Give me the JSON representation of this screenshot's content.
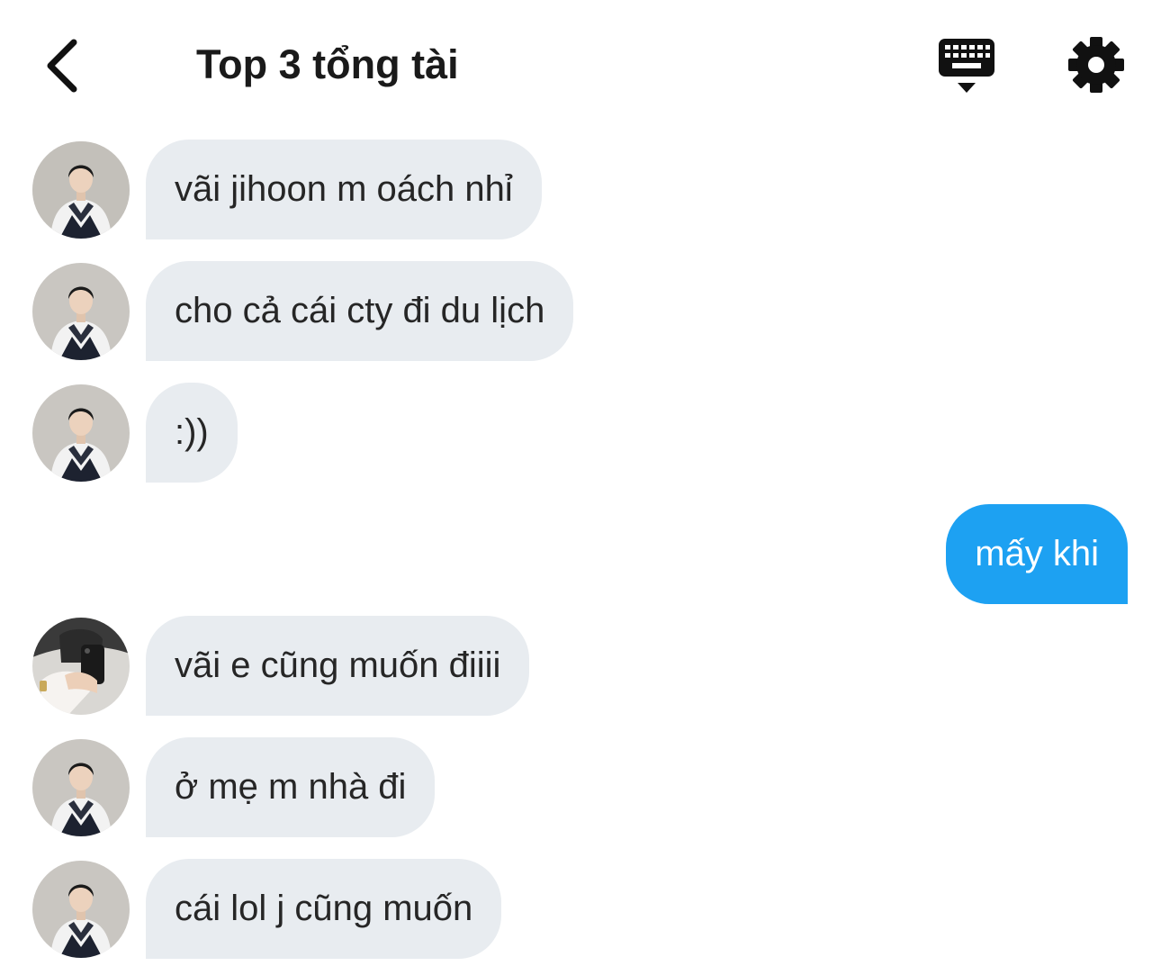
{
  "header": {
    "title": "Top 3 tổng tài",
    "back_icon": "chevron-left-icon",
    "keyboard_icon": "keyboard-icon",
    "settings_icon": "gear-icon"
  },
  "colors": {
    "incoming_bubble": "#e8ecf0",
    "outgoing_bubble": "#1da1f2",
    "outgoing_text": "#ffffff"
  },
  "messages": [
    {
      "direction": "incoming",
      "text": "vãi jihoon m oách nhỉ",
      "avatar": "avatar-user-a"
    },
    {
      "direction": "incoming",
      "text": "cho cả cái cty đi du lịch",
      "avatar": "avatar-user-a"
    },
    {
      "direction": "incoming",
      "text": ":))",
      "avatar": "avatar-user-a"
    },
    {
      "direction": "outgoing",
      "text": "mấy khi"
    },
    {
      "direction": "incoming",
      "text": "vãi e cũng muốn điiii",
      "avatar": "avatar-user-b"
    },
    {
      "direction": "incoming",
      "text": "ở mẹ m nhà đi",
      "avatar": "avatar-user-a"
    },
    {
      "direction": "incoming",
      "text": "cái lol j cũng muốn",
      "avatar": "avatar-user-a"
    }
  ]
}
